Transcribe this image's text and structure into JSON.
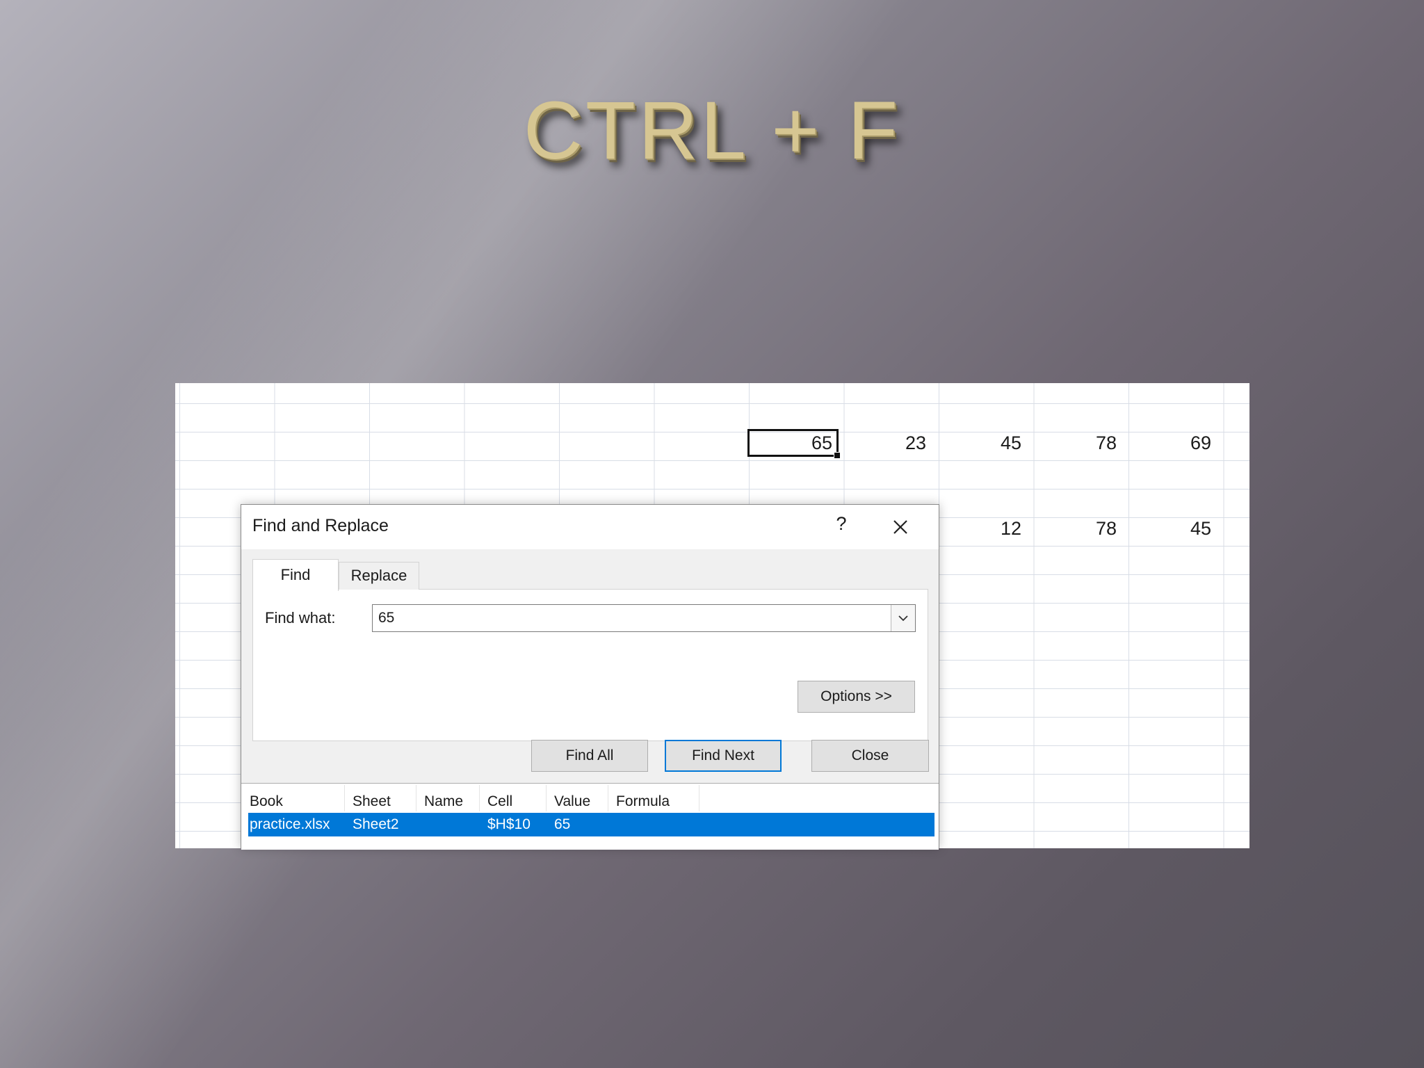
{
  "slide": {
    "title": "CTRL + F"
  },
  "spreadsheet": {
    "row1": [
      "65",
      "23",
      "45",
      "78",
      "69"
    ],
    "row2": [
      "12",
      "78",
      "45"
    ]
  },
  "dialog": {
    "title": "Find and Replace",
    "help_label": "?",
    "tabs": [
      {
        "label": "Find",
        "active": true
      },
      {
        "label": "Replace",
        "active": false
      }
    ],
    "find_what_label": "Find what:",
    "find_what_value": "65",
    "options_label": "Options >>",
    "find_all_label": "Find All",
    "find_next_label": "Find Next",
    "close_label": "Close",
    "results": {
      "columns": [
        "Book",
        "Sheet",
        "Name",
        "Cell",
        "Value",
        "Formula"
      ],
      "rows": [
        {
          "book": "practice.xlsx",
          "sheet": "Sheet2",
          "name": "",
          "cell": "$H$10",
          "value": "65",
          "formula": ""
        }
      ]
    }
  },
  "colors": {
    "selection": "#0078d7",
    "title_gold": "#d6c692"
  },
  "icons": {
    "close": "close-icon",
    "dropdown": "chevron-down-icon"
  }
}
